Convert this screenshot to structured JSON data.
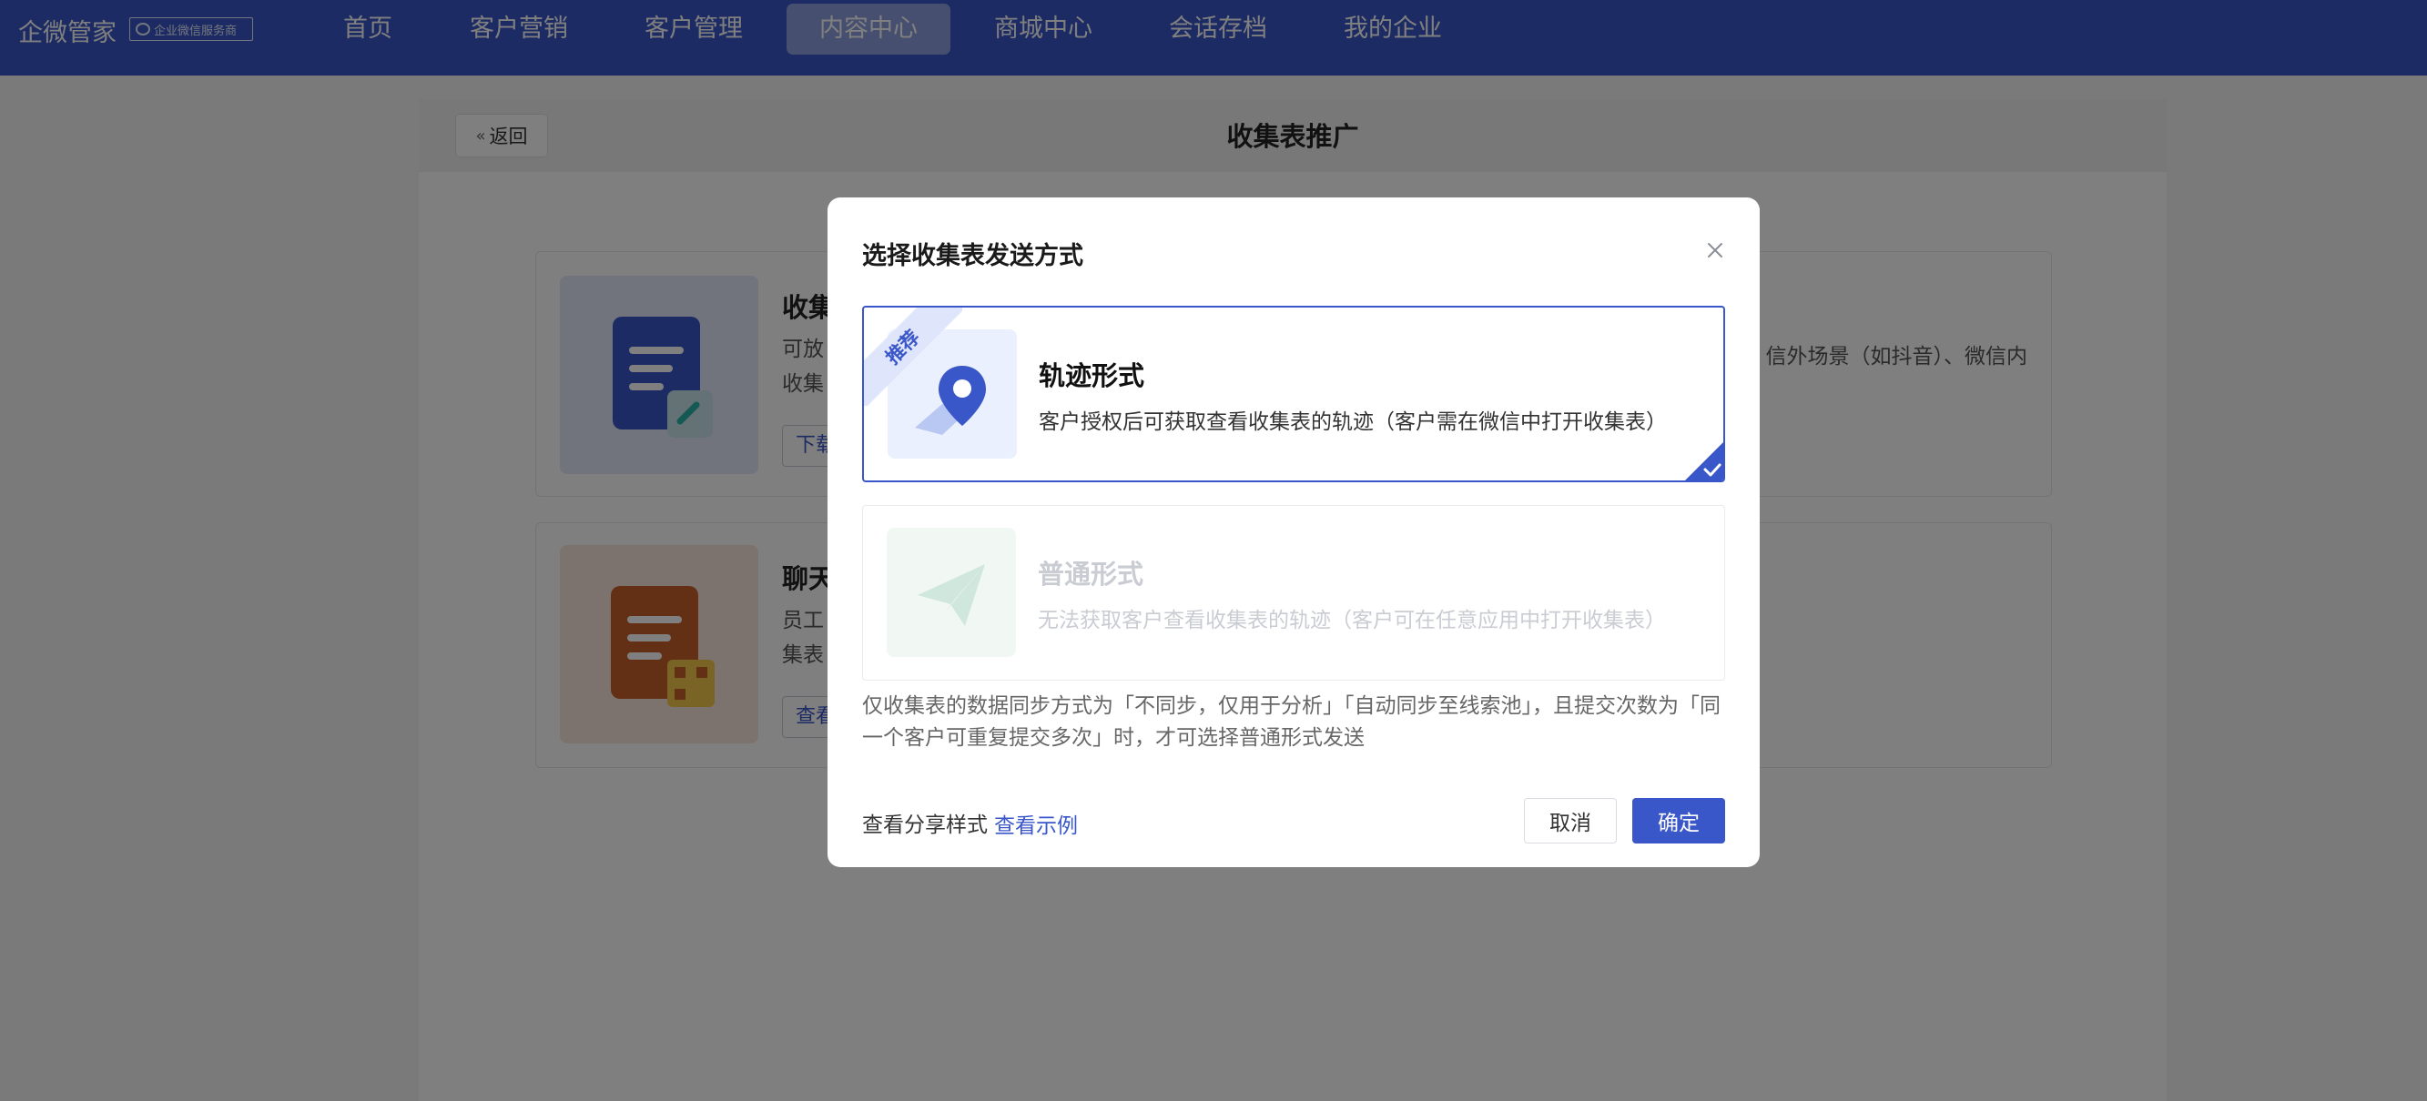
{
  "topbar": {
    "brand": "企微管家",
    "badge": "企业微信服务商",
    "nav": [
      {
        "label": "首页",
        "active": false
      },
      {
        "label": "客户营销",
        "active": false
      },
      {
        "label": "客户管理",
        "active": false
      },
      {
        "label": "内容中心",
        "active": true
      },
      {
        "label": "商城中心",
        "active": false
      },
      {
        "label": "会话存档",
        "active": false
      },
      {
        "label": "我的企业",
        "active": false
      }
    ]
  },
  "page": {
    "back_label": "返回",
    "title": "收集表推广",
    "cards": [
      {
        "title_visible": "收集",
        "desc_line1_visible": "可放",
        "desc_line2_visible": "收集",
        "desc_right_visible": "信外场景（如抖音）、微信内",
        "button_visible": "下载"
      },
      {
        "title_visible": "聊天",
        "desc_line1_visible": "员工",
        "desc_line2_visible": "集表",
        "button_visible": "查看"
      }
    ]
  },
  "modal": {
    "title": "选择收集表发送方式",
    "options": [
      {
        "ribbon": "推荐",
        "title": "轨迹形式",
        "desc": "客户授权后可获取查看收集表的轨迹（客户需在微信中打开收集表）",
        "selected": true,
        "icon": "location-pin-icon"
      },
      {
        "title": "普通形式",
        "desc": "无法获取客户查看收集表的轨迹（客户可在任意应用中打开收集表）",
        "selected": false,
        "disabled": true,
        "icon": "paper-plane-icon"
      }
    ],
    "note": "仅收集表的数据同步方式为「不同步，仅用于分析」「自动同步至线索池」，且提交次数为「同一个客户可重复提交多次」时，才可选择普通形式发送",
    "share_label": "查看分享样式",
    "share_link": "查看示例",
    "cancel": "取消",
    "confirm": "确定"
  },
  "colors": {
    "primary": "#3a57c9",
    "topbar": "#3a57c9",
    "active_nav": "#8e9fe2"
  }
}
